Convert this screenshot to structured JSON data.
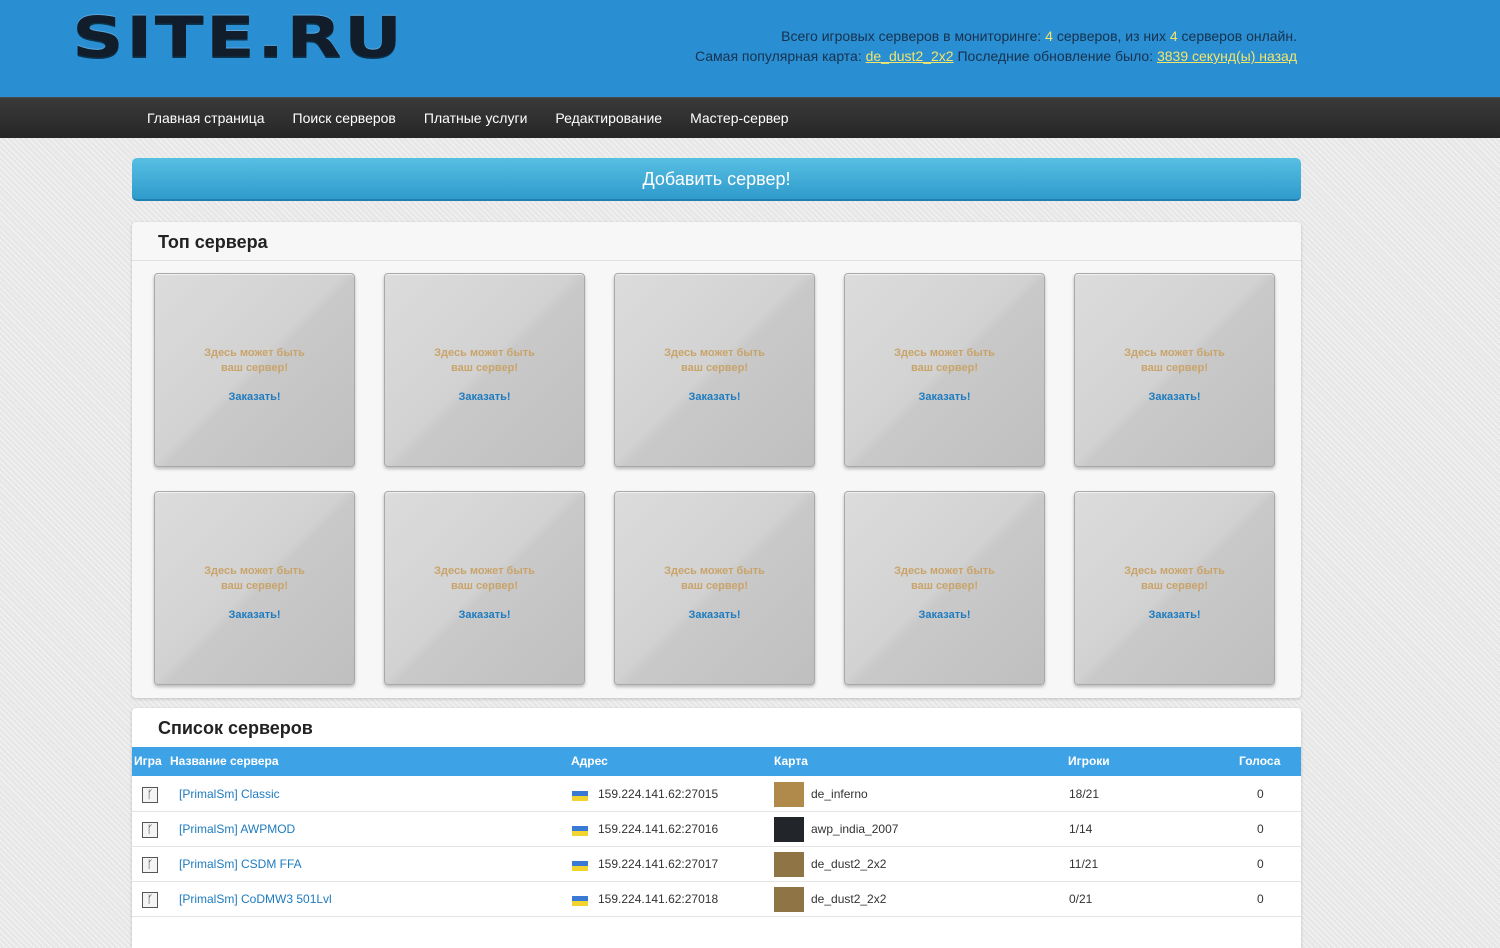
{
  "header": {
    "logo": "SITE.RU",
    "stats": {
      "line1_prefix": "Всего игровых серверов в мониторинге:",
      "total": "4",
      "line1_mid": "серверов, из них",
      "online": "4",
      "line1_suffix": "серверов онлайн.",
      "line2_prefix": "Самая популярная карта:",
      "popular_map": "de_dust2_2x2",
      "line2_mid": "Последние обновление было:",
      "last_update": "3839 секунд(ы) назад"
    }
  },
  "nav": {
    "items": [
      "Главная страница",
      "Поиск серверов",
      "Платные услуги",
      "Редактирование",
      "Мастер-сервер"
    ]
  },
  "add_button": "Добавить сервер!",
  "top": {
    "title": "Топ сервера",
    "slot_line1": "Здесь может быть",
    "slot_line2": "ваш сервер!",
    "slot_link": "Заказать!"
  },
  "list": {
    "title": "Список серверов",
    "columns": [
      "Игра",
      "Название сервера",
      "Адрес",
      "Карта",
      "Игроки",
      "Голоса"
    ],
    "rows": [
      {
        "name": "[PrimalSm] Classic",
        "address": "159.224.141.62:27015",
        "map": "de_inferno",
        "players": "18/21",
        "votes": "0",
        "map_color": "#b08a4a"
      },
      {
        "name": "[PrimalSm] AWPMOD",
        "address": "159.224.141.62:27016",
        "map": "awp_india_2007",
        "players": "1/14",
        "votes": "0",
        "map_color": "#22252a"
      },
      {
        "name": "[PrimalSm] CSDM FFA",
        "address": "159.224.141.62:27017",
        "map": "de_dust2_2x2",
        "players": "11/21",
        "votes": "0",
        "map_color": "#8f7446"
      },
      {
        "name": "[PrimalSm] CoDMW3 501Lvl",
        "address": "159.224.141.62:27018",
        "map": "de_dust2_2x2",
        "players": "0/21",
        "votes": "0",
        "map_color": "#8f7446"
      }
    ]
  },
  "colors": {
    "header_bg": "#2a8ed2",
    "nav_bg": "#2e2e2e",
    "accent": "#3ea3e6",
    "highlight": "#f2e56b",
    "link": "#1d7bbf"
  }
}
